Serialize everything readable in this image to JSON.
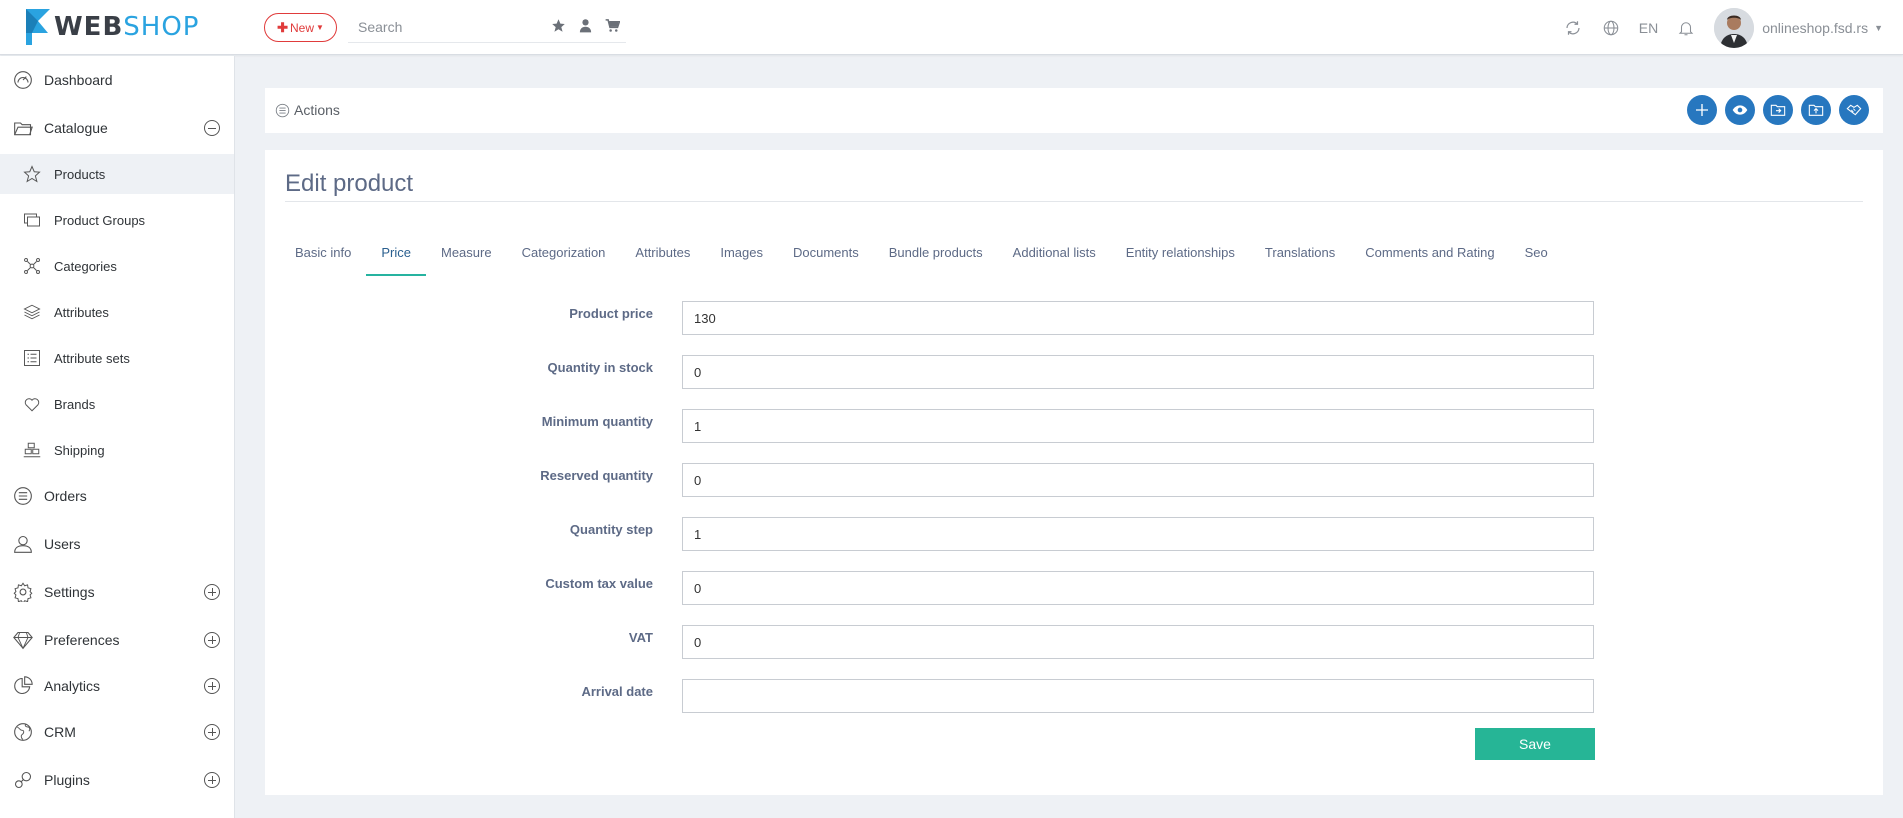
{
  "header": {
    "logo": {
      "part1": "WEB",
      "part2": "SHOP"
    },
    "new_button": "New",
    "search": {
      "placeholder": "Search",
      "value": ""
    },
    "language": "EN",
    "user_name": "onlineshop.fsd.rs"
  },
  "sidebar": {
    "items": [
      {
        "label": "Dashboard",
        "icon": "dashboard-icon"
      },
      {
        "label": "Catalogue",
        "icon": "folder-icon",
        "toggle": "collapse"
      },
      {
        "label": "Products",
        "icon": "star-icon",
        "sub": true,
        "active": true
      },
      {
        "label": "Product Groups",
        "icon": "product-groups-icon",
        "sub": true
      },
      {
        "label": "Categories",
        "icon": "categories-icon",
        "sub": true
      },
      {
        "label": "Attributes",
        "icon": "layers-icon",
        "sub": true
      },
      {
        "label": "Attribute sets",
        "icon": "list-icon",
        "sub": true
      },
      {
        "label": "Brands",
        "icon": "heart-icon",
        "sub": true
      },
      {
        "label": "Shipping",
        "icon": "shipping-icon",
        "sub": true
      },
      {
        "label": "Orders",
        "icon": "orders-icon"
      },
      {
        "label": "Users",
        "icon": "users-icon"
      },
      {
        "label": "Settings",
        "icon": "gear-icon",
        "toggle": "expand"
      },
      {
        "label": "Preferences",
        "icon": "diamond-icon",
        "toggle": "expand"
      },
      {
        "label": "Analytics",
        "icon": "pie-chart-icon",
        "toggle": "expand"
      },
      {
        "label": "CRM",
        "icon": "globe-icon",
        "toggle": "expand"
      },
      {
        "label": "Plugins",
        "icon": "plugins-icon",
        "toggle": "expand"
      }
    ]
  },
  "actions": {
    "label": "Actions",
    "buttons": [
      "add-icon",
      "eye-icon",
      "folder-export-icon",
      "folder-upload-icon",
      "handshake-icon"
    ]
  },
  "main": {
    "title": "Edit product",
    "tabs": [
      {
        "label": "Basic info"
      },
      {
        "label": "Price",
        "active": true
      },
      {
        "label": "Measure"
      },
      {
        "label": "Categorization"
      },
      {
        "label": "Attributes"
      },
      {
        "label": "Images"
      },
      {
        "label": "Documents"
      },
      {
        "label": "Bundle products"
      },
      {
        "label": "Additional lists"
      },
      {
        "label": "Entity relationships"
      },
      {
        "label": "Translations"
      },
      {
        "label": "Comments and Rating"
      },
      {
        "label": "Seo"
      }
    ],
    "form": [
      {
        "label": "Product price",
        "value": "130"
      },
      {
        "label": "Quantity in stock",
        "value": "0"
      },
      {
        "label": "Minimum quantity",
        "value": "1"
      },
      {
        "label": "Reserved quantity",
        "value": "0"
      },
      {
        "label": "Quantity step",
        "value": "1"
      },
      {
        "label": "Custom tax value",
        "value": "0"
      },
      {
        "label": "VAT",
        "value": "0"
      },
      {
        "label": "Arrival date",
        "value": ""
      }
    ],
    "save_label": "Save"
  },
  "colors": {
    "accent_blue": "#2777bf",
    "save_green": "#26b596",
    "new_red": "#e03b3b",
    "tab_underline": "#26b3a0",
    "logo_blue": "#2aa3e0"
  }
}
